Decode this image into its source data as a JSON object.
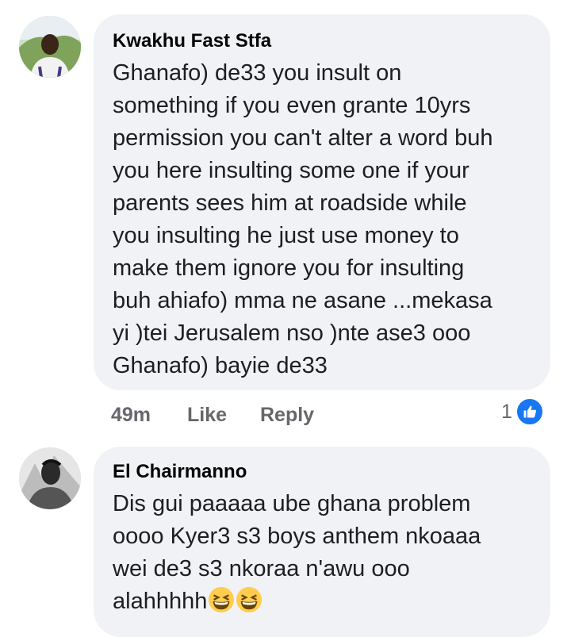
{
  "comments": [
    {
      "author": "Kwakhu Fast Stfa",
      "text": "Ghanafo) de33 you insult on\nsomething if you even grante 10yrs\npermission you can't alter a word buh\nyou here insulting some one if your\nparents sees him at roadside while\nyou insulting he just use money to\nmake them ignore you for insulting\nbuh ahiafo) mma ne asane ...mekasa\nyi )tei Jerusalem nso )nte ase3 ooo\nGhanafo) bayie de33",
      "time": "49m",
      "like_label": "Like",
      "reply_label": "Reply",
      "reaction_count": "1",
      "reaction_icon": "like-icon",
      "accent_color": "#1877f2"
    },
    {
      "author": "El Chairmanno",
      "text": "Dis gui paaaaa ube ghana problem\noooo Kyer3 s3 boys anthem nkoaaa\nwei de3 s3 nkoraa n'awu ooo\nalahhhhh",
      "emojis": [
        "grinning-squinting-face",
        "grinning-squinting-face"
      ]
    }
  ]
}
